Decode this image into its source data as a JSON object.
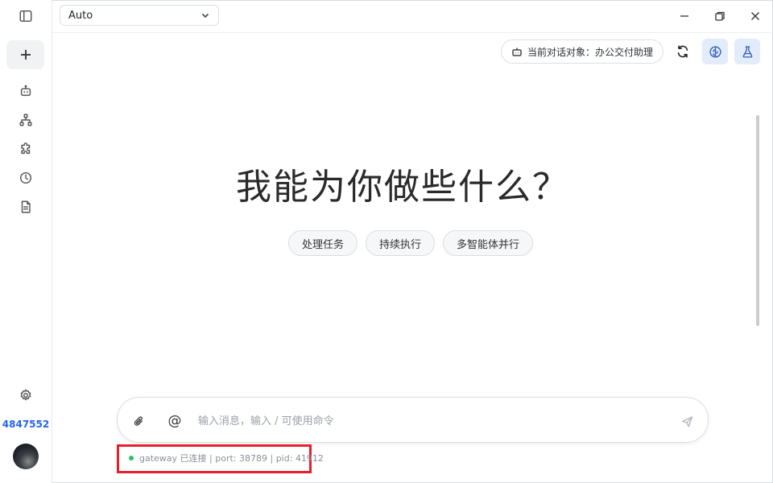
{
  "model_select": {
    "value": "Auto"
  },
  "context": {
    "label": "当前对话对象：办公交付助理"
  },
  "hero": {
    "title": "我能为你做些什么？"
  },
  "chips": [
    {
      "label": "处理任务"
    },
    {
      "label": "持续执行"
    },
    {
      "label": "多智能体并行"
    }
  ],
  "composer": {
    "placeholder": "输入消息，输入 / 可使用命令",
    "at_symbol": "@"
  },
  "status": {
    "text": "gateway 已连接 | port: 38789 | pid: 41912",
    "connected_color": "#22c55e"
  },
  "user": {
    "id": "4847552"
  },
  "colors": {
    "accent": "#2563eb",
    "highlight_box": "#e5202e",
    "tool_button_bg": "#e3ecfb"
  }
}
